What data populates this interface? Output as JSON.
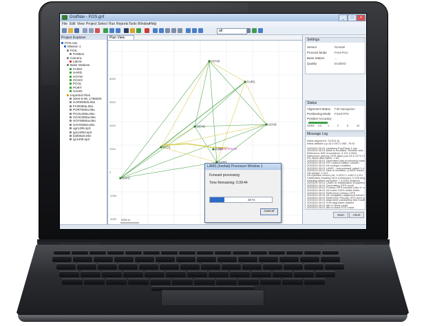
{
  "window": {
    "title": "GrafNav - POS.gnf",
    "buttons": [
      "_",
      "□",
      "×"
    ]
  },
  "menu": [
    "File",
    "Edit",
    "View",
    "Project",
    "Select",
    "Run",
    "Reports",
    "Tools",
    "Window",
    "Help"
  ],
  "toolbar": {
    "combo_value": "all"
  },
  "explorer": {
    "header": "Project Explorer",
    "items": [
      {
        "label": "POS.nav",
        "level": 0,
        "color": "#2a6fd0"
      },
      {
        "label": "Mission 1",
        "level": 1,
        "color": "#2a6fd0"
      },
      {
        "label": "POS",
        "level": 2,
        "color": "#888"
      },
      {
        "label": "Position",
        "level": 3,
        "color": "#888"
      },
      {
        "label": "Camera",
        "level": 2,
        "color": "#888"
      },
      {
        "label": "LMHS",
        "level": 3,
        "color": "#d33"
      },
      {
        "label": "Base Stations",
        "level": 2,
        "color": "#888"
      },
      {
        "label": "FAIRS",
        "level": 3,
        "color": "#3a3"
      },
      {
        "label": "HARD",
        "level": 3,
        "color": "#3a3"
      },
      {
        "label": "HOYM",
        "level": 3,
        "color": "#3a3"
      },
      {
        "label": "OCHO",
        "level": 3,
        "color": "#3a3"
      },
      {
        "label": "PCOL",
        "level": 3,
        "color": "#3a3"
      },
      {
        "label": "PORT",
        "level": 3,
        "color": "#3a3"
      },
      {
        "label": "UGHD",
        "level": 3,
        "color": "#3a3"
      },
      {
        "label": "Imported Files",
        "level": 2,
        "color": "#e0a020"
      },
      {
        "label": "2004-5-06_1785000",
        "level": 3,
        "color": "#888"
      },
      {
        "label": "HARD060a.06o",
        "level": 3,
        "color": "#888"
      },
      {
        "label": "FAIR060a.06o",
        "level": 3,
        "color": "#888"
      },
      {
        "label": "PORT060a.06o",
        "level": 3,
        "color": "#888"
      },
      {
        "label": "PCOL060a.06o",
        "level": 3,
        "color": "#888"
      },
      {
        "label": "OCHO060a.06o",
        "level": 3,
        "color": "#888"
      },
      {
        "label": "HOYM060a.06o",
        "level": 3,
        "color": "#888"
      },
      {
        "label": "SAVO060a.06o",
        "level": 3,
        "color": "#888"
      },
      {
        "label": "ugr1405.sp3",
        "level": 3,
        "color": "#888"
      },
      {
        "label": "igs14053.sp3",
        "level": 3,
        "color": "#888"
      },
      {
        "label": "bolt0620.06n",
        "level": 3,
        "color": "#888"
      },
      {
        "label": "igr1408.sp3",
        "level": 3,
        "color": "#888"
      }
    ]
  },
  "plan": {
    "tab_label": "Plan View",
    "stations": [
      {
        "name": "HOYM"
      },
      {
        "name": "FAIRS"
      },
      {
        "name": "UGHD"
      },
      {
        "name": "OCHO"
      },
      {
        "name": "PCOL"
      },
      {
        "name": "HARD"
      },
      {
        "name": "SAVO"
      },
      {
        "name": "PORT"
      }
    ],
    "trajectory_label": "Frame 370419",
    "scale_label": "2000 m",
    "y_ticks": [
      "8000",
      "6000",
      "4000",
      "2000",
      "0",
      "-2000",
      "-4000"
    ]
  },
  "settings": {
    "header": "Settings",
    "rows": [
      {
        "label": "Sensor",
        "value": "Novatel"
      },
      {
        "label": "Process Mode",
        "value": "Post-Proc"
      },
      {
        "label": "Base Station",
        "value": "..."
      },
      {
        "label": "Quality",
        "value": "Enabled"
      }
    ]
  },
  "status": {
    "header": "Status",
    "rows": [
      {
        "label": "Alignment Status",
        "value": "Full Navigation"
      },
      {
        "label": "Positioning Mode",
        "value": "Fixed RTK"
      },
      {
        "label": "Position Accuracy",
        "value": ""
      }
    ],
    "scale_marks": [
      "GNSS",
      "0.5",
      "1",
      "2",
      "5",
      "10"
    ]
  },
  "message_log": {
    "header": "Message Log",
    "lines": [
      "Initial alignment:       7(1024.6)",
      "Initial attitude (r,p,h)   0.091 0.265 -79.61",
      "",
      "20/03/24 00:01  Updating PosiTrack 1 sys",
      "20/03/24 00:01  Base is modified. Refresh stat...",
      "Reference INS Uncertainty:  3.101  2.5511",
      "Reference primary GPS base pos   23.5  1273   177",
      "IRL-Bank  alternative:     2.53",
      "20/03/24 00:01  Generated last processing station",
      "20/03/24 00:01  PP/ nearest station chosen",
      "20/03/24 00:01  28 lookups modified",
      "20/03/24 00:01  LAMS - reprocessed output 1.4 dispo...",
      "20/03/24 00:01  New is modified. (LAMS result)",
      "Lift weight:          2.012",
      "Lift injection vector (m):  0.2010  1.1481  0.1211",
      "Calibration heading error (m/s/scan): 0.026 degrees",
      "Heading offset correction = 0.0051 degrees",
      "20/03/24 00:01  LAMS re-initialization completed",
      "20/03/24 00:01  Generating GPS result",
      "20/03/24 00:01  Primary GPS solution ratio 3+ sat",
      "20/03/24 00:01  28 found 100% within limits",
      "20/03/24 00:01  Reference primary GPS",
      "20/03/24 00:01  28 navigation alignment solved",
      "20/03/24 00:01  Reference Primary GPS done pos",
      "20/03/24 00:01  Alignment positioning fine mode",
      "20/03/24 00:01  Free alignment started",
      "20/03/24 00:01  Afix to fixed mode",
      "20/03/24 00:01  Afix to fixed RTK mode"
    ],
    "buttons": [
      "Start",
      "Abort"
    ]
  },
  "dialog": {
    "title": "LAMS (Inertial) Processor Window 1",
    "line1": "Forward processing",
    "line2": "Time Remaining: 0:39:44",
    "progress": 0.23,
    "progress_label": "23 %",
    "cancel": "Cancel"
  },
  "colors": {
    "accent": "#2d6bc9",
    "network_line": "#3a9a3a",
    "trajectory": "#d4c63a"
  }
}
